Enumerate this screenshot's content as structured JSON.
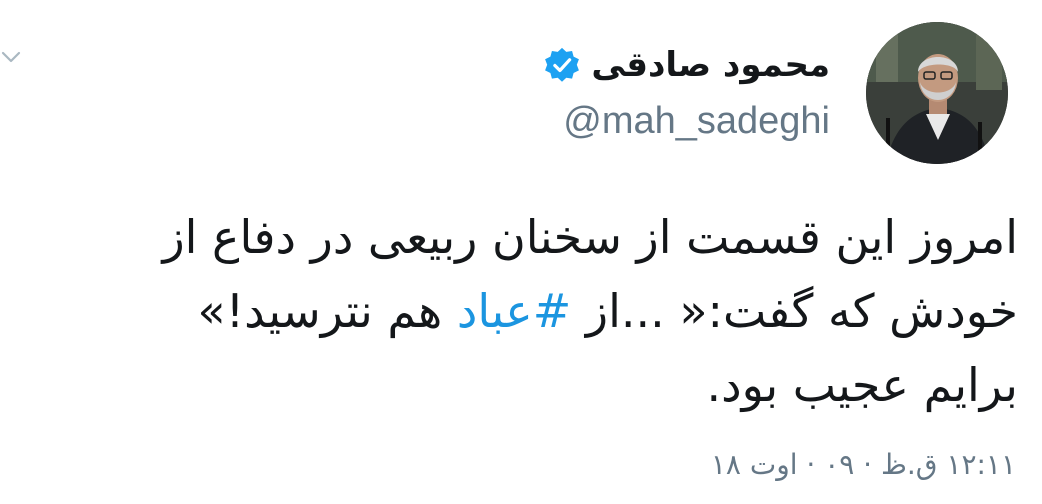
{
  "author": {
    "display_name": "محمود صادقی",
    "handle": "@mah_sadeghi",
    "verified": true,
    "avatar_icon": "avatar-photo"
  },
  "tweet": {
    "line1": "امروز این قسمت از سخنان ربیعی در دفاع از",
    "line2_before": "خودش که گفت:« ...از ",
    "hashtag": "#عباد",
    "line2_after": " هم نترسید!»",
    "line3": "برایم عجیب بود."
  },
  "meta": {
    "timestamp": "۱۲:۱۱ ق.ظ · ۰۹ · اوت ۱۸"
  },
  "icons": {
    "caret": "chevron-down-icon",
    "verified": "verified-badge-icon"
  },
  "colors": {
    "hashtag": "#1b95e0",
    "secondary_text": "#657786",
    "verified": "#1da1f2"
  }
}
